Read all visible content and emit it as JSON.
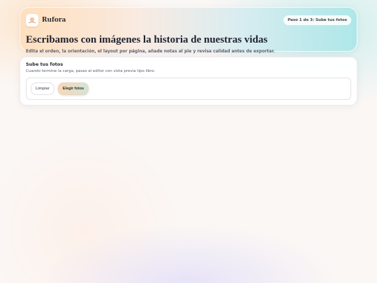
{
  "header": {
    "brand": "Rufora",
    "step_badge": "Paso 1 de 3: Sube tus fotos",
    "title": "Escribamos con imágenes la historia de nuestras vidas",
    "subtitle": "Edita el orden, la orientación, el layout por página, añade notas al pie y revisa calidad antes de exportar."
  },
  "upload": {
    "title": "Sube tus fotos",
    "subtitle": "Cuando termine la carga, pasas al editor con vista previa tipo libro.",
    "clear_label": "Limpiar",
    "choose_label": "Elegir fotos"
  },
  "colors": {
    "accent_peach": "#fad7b6",
    "accent_teal": "#a8e8e8"
  },
  "icons": {
    "logo": "rufora-logo-icon"
  }
}
